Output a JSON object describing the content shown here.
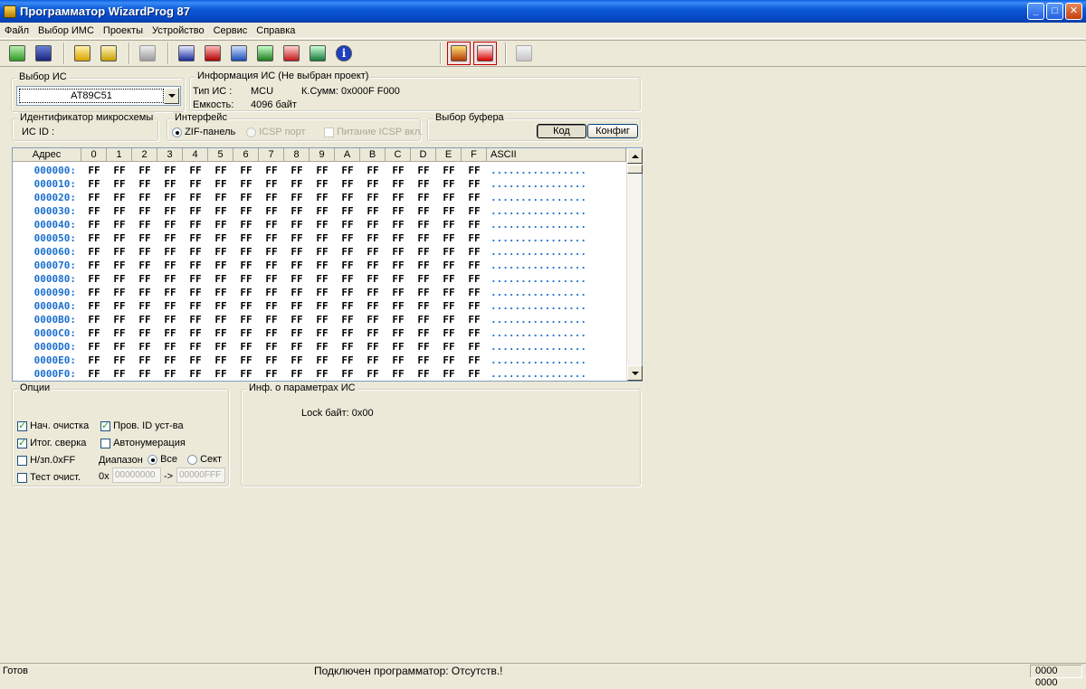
{
  "window": {
    "title": "Программатор WizardProg 87",
    "min": "_",
    "max": "□",
    "close": "✕"
  },
  "menu": [
    "Файл",
    "Выбор ИМС",
    "Проекты",
    "Устройство",
    "Сервис",
    "Справка"
  ],
  "toolbar_icons": [
    "open-icon",
    "save-icon",
    "folder-icon",
    "folder-edit-icon",
    "calculator-icon",
    "chip-id-icon",
    "read-icon",
    "chip-icon",
    "program-icon",
    "verify-icon",
    "erase-icon",
    "info-icon",
    "run-icon",
    "auto-icon",
    "exit-icon"
  ],
  "chip_select": {
    "legend": "Выбор ИС",
    "value": "AT89C51"
  },
  "chip_info": {
    "legend": "Информация ИС (Не выбран проект)",
    "type_label": "Тип ИС  :",
    "type_value": "MCU",
    "checksum": "К.Сумм: 0x000F F000",
    "size_label": "Емкость:",
    "size_value": "4096 байт"
  },
  "chip_id": {
    "legend": "Идентификатор микросхемы",
    "label": "ИС ID :"
  },
  "interface": {
    "legend": "Интерфейс",
    "zif": "ZIF-панель",
    "icsp": "ICSP порт",
    "icsp_power": "Питание ICSP вкл."
  },
  "buffer": {
    "legend": "Выбор буфера",
    "code": "Код",
    "config": "Конфиг"
  },
  "grid": {
    "addr_header": "Адрес",
    "cols": [
      "0",
      "1",
      "2",
      "3",
      "4",
      "5",
      "6",
      "7",
      "8",
      "9",
      "A",
      "B",
      "C",
      "D",
      "E",
      "F"
    ],
    "ascii_header": "ASCII",
    "byte": "FF",
    "ascii_row": "................",
    "rows": [
      "000000:",
      "000010:",
      "000020:",
      "000030:",
      "000040:",
      "000050:",
      "000060:",
      "000070:",
      "000080:",
      "000090:",
      "0000A0:",
      "0000B0:",
      "0000C0:",
      "0000D0:",
      "0000E0:",
      "0000F0:"
    ]
  },
  "options": {
    "legend": "Опции",
    "initial_erase": "Нач. очистка",
    "check_id": "Пров. ID уст-ва",
    "final_verify": "Итог. сверка",
    "autonumber": "Автонумерация",
    "not_ff": "Н/зп.0xFF",
    "test_erase": "Тест очист.",
    "range_label": "Диапазон",
    "range_all": "Все",
    "range_sector": "Сект",
    "hex_prefix": "0x",
    "range_from": "00000000",
    "range_arrow": "->",
    "range_to": "00000FFF"
  },
  "params": {
    "legend": "Инф. о параметрах ИС",
    "lock": "Lock байт: 0x00"
  },
  "status": {
    "left": "Готов",
    "center": "Подключен программатор: Отсутств.!",
    "right": "0000 0000"
  }
}
